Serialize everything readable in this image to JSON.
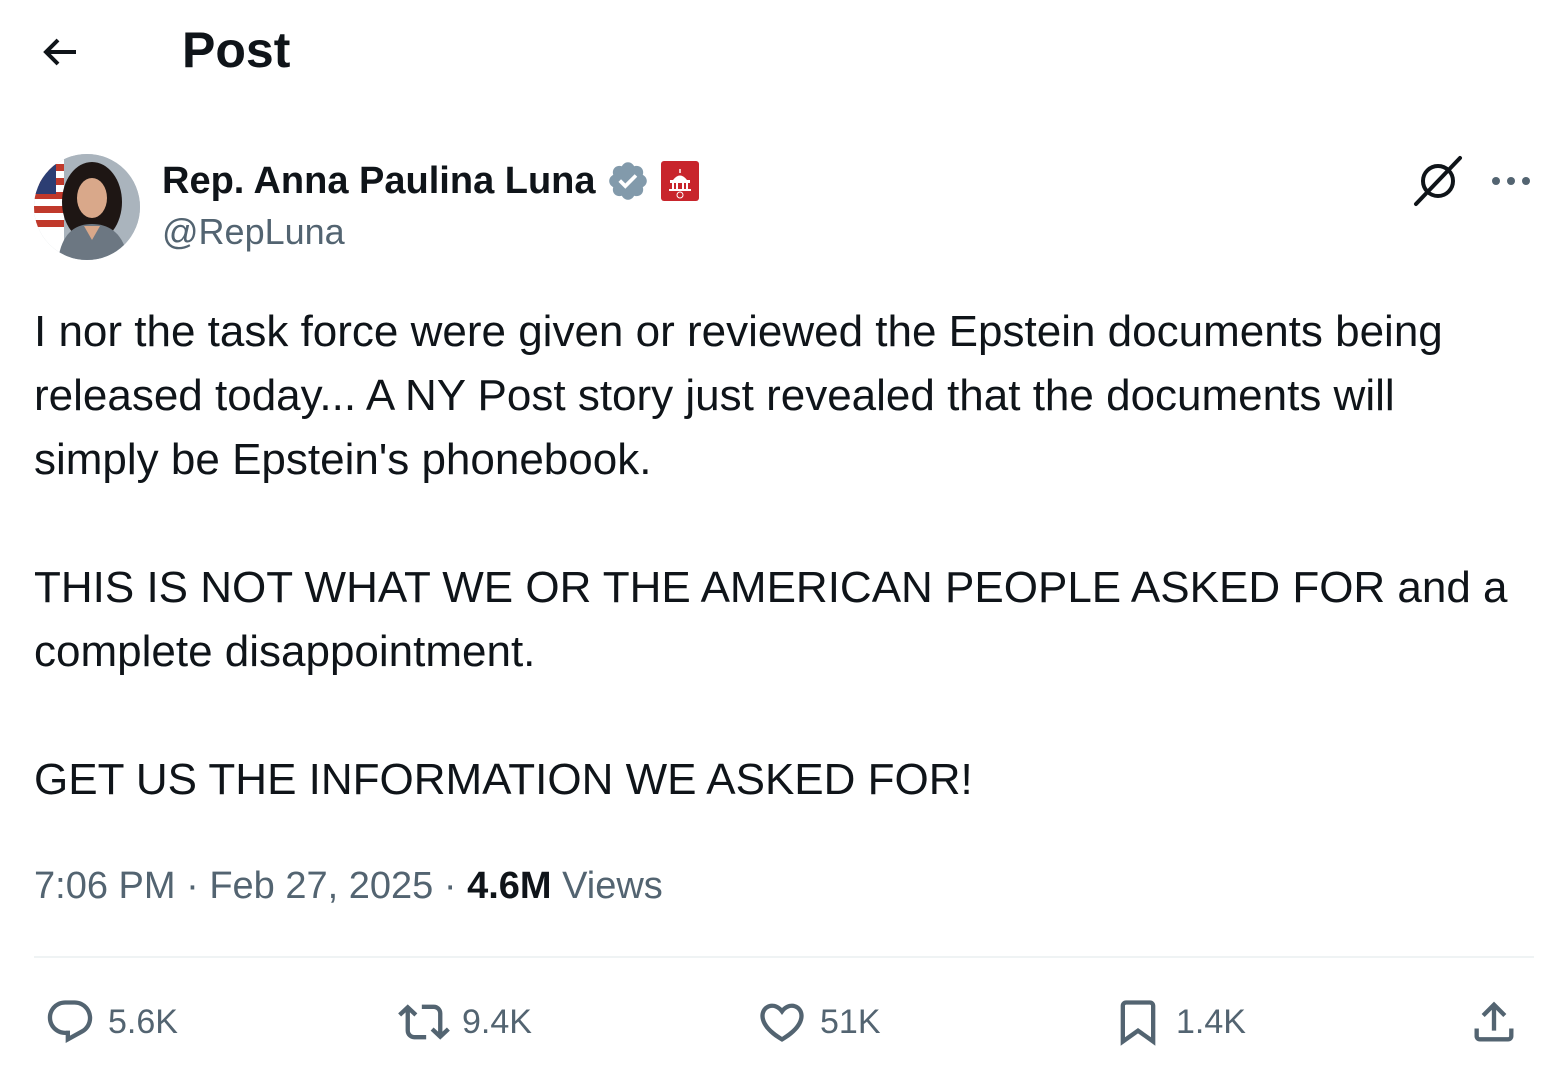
{
  "header": {
    "title": "Post",
    "back_icon": "arrow-left-icon"
  },
  "author": {
    "name": "Rep. Anna Paulina Luna",
    "handle": "@RepLuna",
    "verified_icon": "verified-badge-icon",
    "affiliation_icon": "capitol-badge-icon"
  },
  "tweet": {
    "paragraphs": [
      "I nor the task force were given or reviewed the Epstein documents being released today... A NY Post story just revealed that the documents will simply be Epstein's phonebook.",
      "THIS IS NOT WHAT WE OR THE AMERICAN PEOPLE ASKED FOR and a complete disappointment.",
      "GET US THE INFORMATION WE ASKED FOR!"
    ]
  },
  "meta": {
    "time": "7:06 PM",
    "separator": "·",
    "date": "Feb 27, 2025",
    "views_count": "4.6M",
    "views_label": "Views"
  },
  "actions": {
    "replies": "5.6K",
    "reposts": "9.4K",
    "likes": "51K",
    "bookmarks": "1.4K"
  },
  "colors": {
    "text_primary": "#0f1419",
    "text_secondary": "#536471",
    "verified_gray": "#829aab",
    "badge_red": "#c8252c",
    "divider": "#eff3f4"
  }
}
